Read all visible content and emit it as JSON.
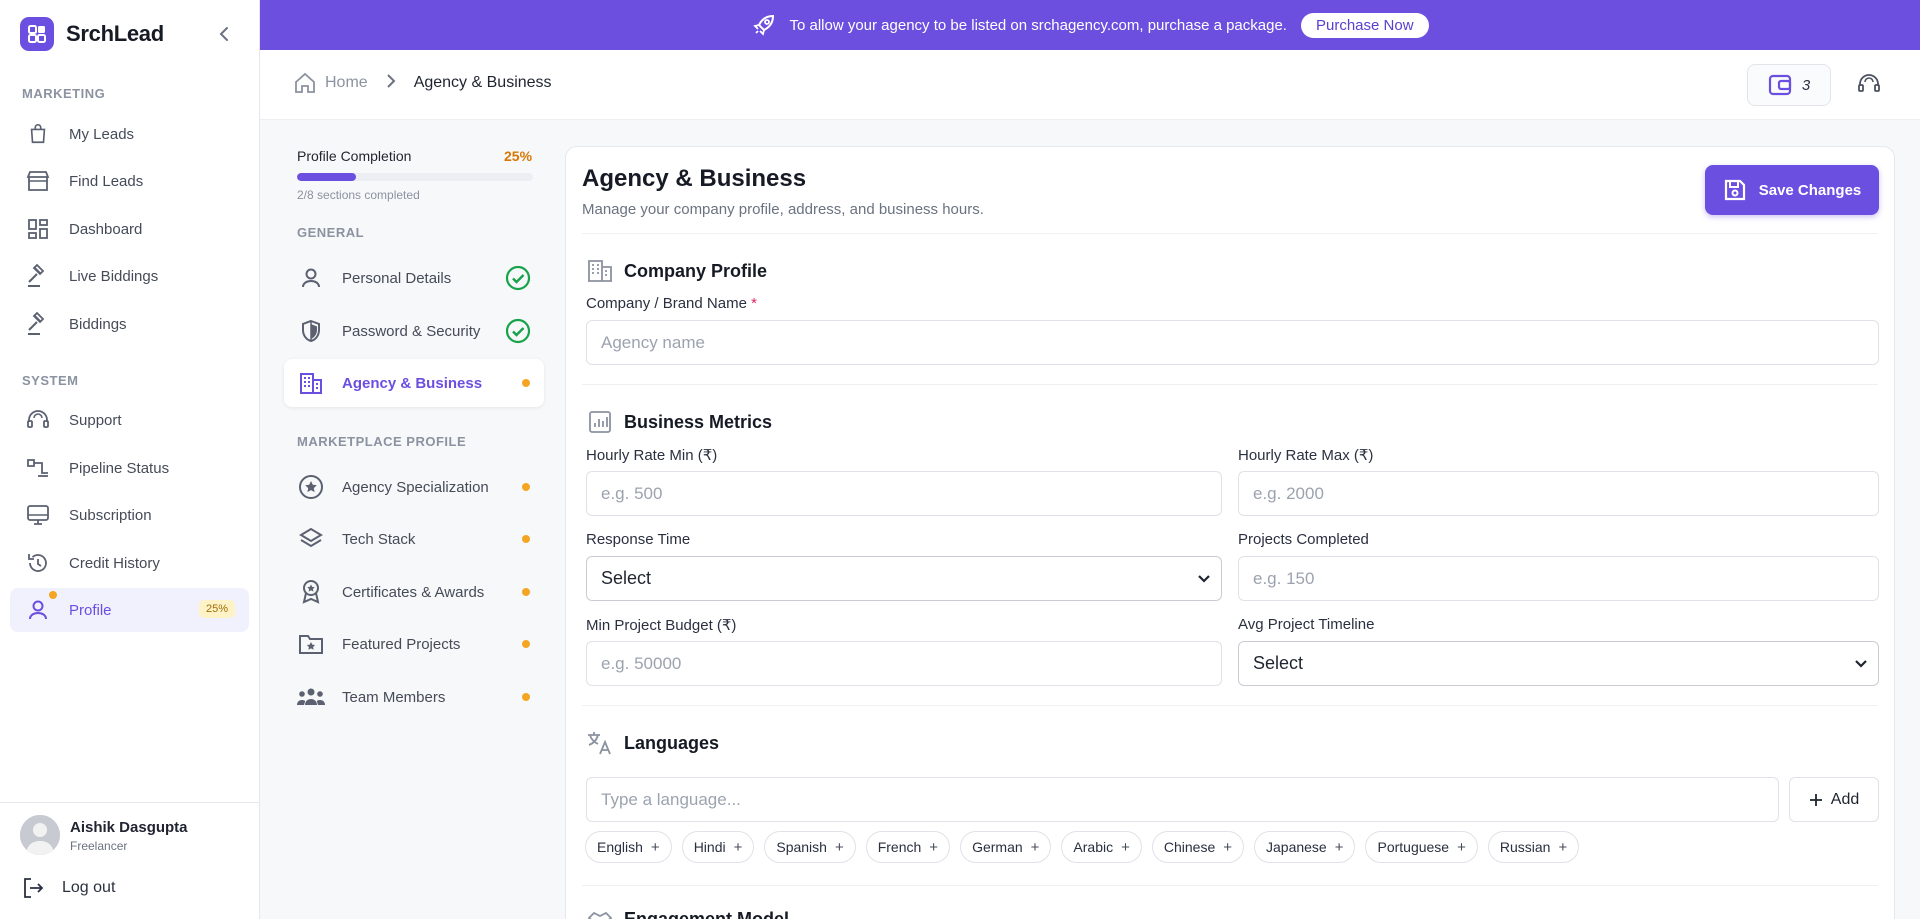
{
  "brand": {
    "name": "SrchLead"
  },
  "sidebar": {
    "marketing_label": "MARKETING",
    "system_label": "SYSTEM",
    "items": [
      {
        "label": "My Leads",
        "icon": "shopping-bag-icon"
      },
      {
        "label": "Find Leads",
        "icon": "store-icon"
      },
      {
        "label": "Dashboard",
        "icon": "dashboard-icon"
      },
      {
        "label": "Live Biddings",
        "icon": "gavel-icon"
      },
      {
        "label": "Biddings",
        "icon": "gavel-icon"
      },
      {
        "label": "Support",
        "icon": "headset-icon"
      },
      {
        "label": "Pipeline Status",
        "icon": "pipeline-icon"
      },
      {
        "label": "Subscription",
        "icon": "monitor-icon"
      },
      {
        "label": "Credit History",
        "icon": "history-icon"
      },
      {
        "label": "Profile",
        "icon": "user-icon",
        "badge": "25%"
      }
    ],
    "user": {
      "name": "Aishik Dasgupta",
      "role": "Freelancer"
    },
    "logout_label": "Log out"
  },
  "banner": {
    "message": "To allow your agency to be listed on srchagency.com, purchase a package.",
    "button_label": "Purchase Now"
  },
  "header": {
    "breadcrumb_home": "Home",
    "breadcrumb_current": "Agency & Business",
    "credits": "3"
  },
  "profile_nav": {
    "completion_label": "Profile Completion",
    "completion_pct": "25%",
    "completion_fraction": 0.25,
    "sections_completed": "2/8 sections completed",
    "general_label": "GENERAL",
    "marketplace_label": "MARKETPLACE PROFILE",
    "general_items": [
      {
        "label": "Personal Details",
        "status": "complete"
      },
      {
        "label": "Password & Security",
        "status": "complete"
      },
      {
        "label": "Agency & Business",
        "status": "pending"
      }
    ],
    "marketplace_items": [
      {
        "label": "Agency Specialization",
        "status": "pending"
      },
      {
        "label": "Tech Stack",
        "status": "pending"
      },
      {
        "label": "Certificates & Awards",
        "status": "pending"
      },
      {
        "label": "Featured Projects",
        "status": "pending"
      },
      {
        "label": "Team Members",
        "status": "pending"
      }
    ]
  },
  "main": {
    "title": "Agency & Business",
    "subtitle": "Manage your company profile, address, and business hours.",
    "save_label": "Save Changes",
    "company_profile": {
      "heading": "Company Profile",
      "brand_name_label": "Company / Brand Name",
      "required_mark": "*",
      "brand_name_placeholder": "Agency name"
    },
    "business_metrics": {
      "heading": "Business Metrics",
      "rate_min_label": "Hourly Rate Min (₹)",
      "rate_min_placeholder": "e.g. 500",
      "rate_max_label": "Hourly Rate Max (₹)",
      "rate_max_placeholder": "e.g. 2000",
      "response_time_label": "Response Time",
      "response_time_value": "Select",
      "projects_completed_label": "Projects Completed",
      "projects_completed_placeholder": "e.g. 150",
      "min_budget_label": "Min Project Budget (₹)",
      "min_budget_placeholder": "e.g. 50000",
      "avg_timeline_label": "Avg Project Timeline",
      "avg_timeline_value": "Select"
    },
    "languages": {
      "heading": "Languages",
      "input_placeholder": "Type a language...",
      "add_label": "Add",
      "chips": [
        "English",
        "Hindi",
        "Spanish",
        "French",
        "German",
        "Arabic",
        "Chinese",
        "Japanese",
        "Portuguese",
        "Russian"
      ]
    },
    "next_section_heading": "Engagement Model"
  },
  "colors": {
    "accent": "#6b4fe0",
    "banner": "#6c4fdf",
    "success": "#16a34a",
    "pending": "#f5a524"
  }
}
